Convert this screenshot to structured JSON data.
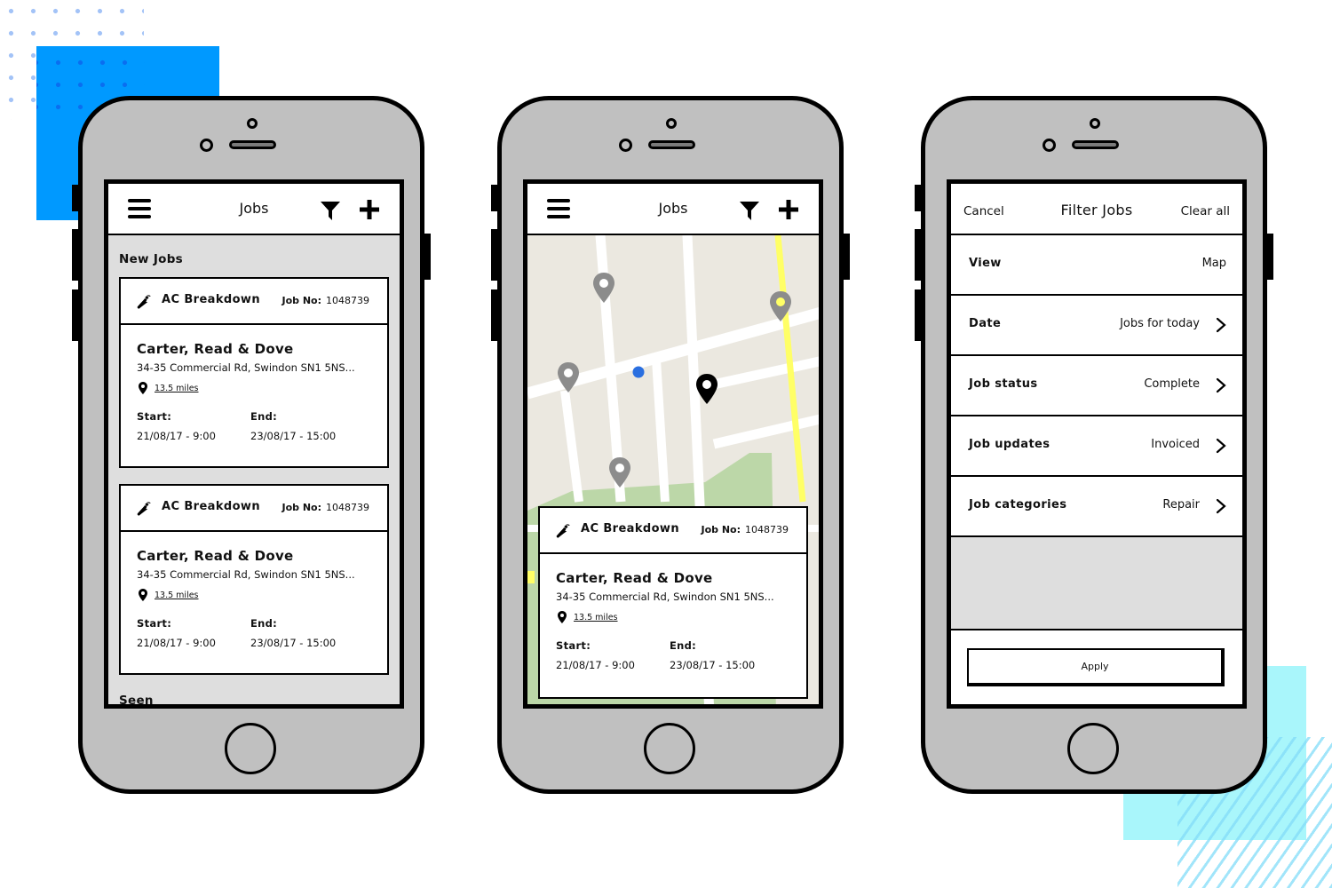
{
  "phones": {
    "list": {
      "nav": {
        "title": "Jobs",
        "menu_icon": "hamburger-icon",
        "filter_icon": "filter-icon",
        "add_icon": "plus-icon"
      },
      "section_new": "New Jobs",
      "section_seen": "Seen",
      "cards": [
        {
          "type": "AC Breakdown",
          "job_no_label": "Job No:",
          "job_no": "1048739",
          "company": "Carter, Read & Dove",
          "address": "34-35 Commercial Rd, Swindon SN1 5NS...",
          "distance": "13.5 miles",
          "start_label": "Start:",
          "start": "21/08/17 - 9:00",
          "end_label": "End:",
          "end": "23/08/17 - 15:00"
        },
        {
          "type": "AC Breakdown",
          "job_no_label": "Job No:",
          "job_no": "1048739",
          "company": "Carter, Read & Dove",
          "address": "34-35 Commercial Rd, Swindon SN1 5NS...",
          "distance": "13.5 miles",
          "start_label": "Start:",
          "start": "21/08/17 - 9:00",
          "end_label": "End:",
          "end": "23/08/17 - 15:00"
        }
      ]
    },
    "map": {
      "nav": {
        "title": "Jobs"
      },
      "markers": [
        {
          "name": "job-marker",
          "state": "inactive"
        },
        {
          "name": "job-marker",
          "state": "inactive"
        },
        {
          "name": "job-marker",
          "state": "inactive"
        },
        {
          "name": "job-marker",
          "state": "inactive"
        },
        {
          "name": "job-marker",
          "state": "selected"
        }
      ],
      "current_location": "blue-dot",
      "colors": {
        "map_bg": "#ebe8e0",
        "road": "#ffffff",
        "highway": "#ffff66",
        "park": "#bcd7a8",
        "marker": "#8c8c8c",
        "marker_selected": "#000000",
        "location": "#2a6fe0"
      },
      "card": {
        "type": "AC Breakdown",
        "job_no_label": "Job No:",
        "job_no": "1048739",
        "company": "Carter, Read & Dove",
        "address": "34-35 Commercial Rd, Swindon SN1 5NS...",
        "distance": "13.5 miles",
        "start_label": "Start:",
        "start": "21/08/17 - 9:00",
        "end_label": "End:",
        "end": "23/08/17 - 15:00"
      }
    },
    "filter": {
      "nav": {
        "cancel": "Cancel",
        "title": "Filter Jobs",
        "clear": "Clear all"
      },
      "rows": [
        {
          "label": "View",
          "value": "Map",
          "has_arrow": false
        },
        {
          "label": "Date",
          "value": "Jobs for today",
          "has_arrow": true
        },
        {
          "label": "Job status",
          "value": "Complete",
          "has_arrow": true
        },
        {
          "label": "Job updates",
          "value": "Invoiced",
          "has_arrow": true
        },
        {
          "label": "Job categories",
          "value": "Repair",
          "has_arrow": true
        }
      ],
      "apply": "Apply"
    }
  },
  "decor": {
    "accent_blue": "#0099ff",
    "accent_cyan": "#a9f6fb",
    "phone_body": "#c0c0c0"
  }
}
